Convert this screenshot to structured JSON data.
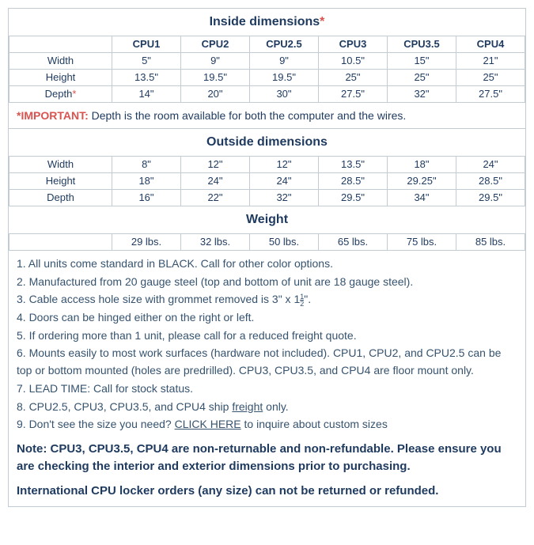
{
  "sections": {
    "inside": {
      "title": "Inside dimensions",
      "hasAsterisk": true
    },
    "outside": {
      "title": "Outside dimensions"
    },
    "weight": {
      "title": "Weight"
    }
  },
  "columns": [
    "CPU1",
    "CPU2",
    "CPU2.5",
    "CPU3",
    "CPU3.5",
    "CPU4"
  ],
  "inside": {
    "rows": {
      "width": {
        "label": "Width",
        "values": [
          "5\"",
          "9\"",
          "9\"",
          "10.5\"",
          "15\"",
          "21\""
        ]
      },
      "height": {
        "label": "Height",
        "values": [
          "13.5\"",
          "19.5\"",
          "19.5\"",
          "25\"",
          "25\"",
          "25\""
        ]
      },
      "depth": {
        "label": "Depth",
        "hasAsterisk": true,
        "values": [
          "14\"",
          "20\"",
          "30\"",
          "27.5\"",
          "32\"",
          "27.5\""
        ]
      }
    }
  },
  "important": {
    "label": "*IMPORTANT:",
    "text": " Depth is the room available for both the computer and the wires."
  },
  "outside": {
    "rows": {
      "width": {
        "label": "Width",
        "values": [
          "8\"",
          "12\"",
          "12\"",
          "13.5\"",
          "18\"",
          "24\""
        ]
      },
      "height": {
        "label": "Height",
        "values": [
          "18\"",
          "24\"",
          "24\"",
          "28.5\"",
          "29.25\"",
          "28.5\""
        ]
      },
      "depth": {
        "label": "Depth",
        "values": [
          "16\"",
          "22\"",
          "32\"",
          "29.5\"",
          "34\"",
          "29.5\""
        ]
      }
    }
  },
  "weight": {
    "values": [
      "29 lbs.",
      "32 lbs.",
      "50 lbs.",
      "65 lbs.",
      "75 lbs.",
      "85 lbs."
    ]
  },
  "notes": {
    "n1": "1. All units come standard in BLACK. Call for other color options.",
    "n2": "2. Manufactured from 20 gauge steel (top and bottom of unit are 18 gauge steel).",
    "n3_a": "3. Cable access hole size with grommet removed is 3\" x 1",
    "n3_num": "1",
    "n3_den": "2",
    "n3_b": "\".",
    "n4": "4. Doors can be hinged either on the right or left.",
    "n5": "5. If ordering more than 1 unit, please call for a reduced freight quote.",
    "n6": "6. Mounts easily to most work surfaces (hardware not included). CPU1, CPU2, and CPU2.5 can be top or bottom mounted (holes are predrilled). CPU3, CPU3.5, and CPU4 are floor mount only.",
    "n7": "7. LEAD TIME: Call for stock status.",
    "n8_a": "8. CPU2.5, CPU3, CPU3.5, and CPU4 ship ",
    "n8_link": "freight",
    "n8_b": " only.",
    "n9_a": "9. Don't see the size you need? ",
    "n9_link": "CLICK HERE",
    "n9_b": " to inquire about custom sizes"
  },
  "bold1": "Note: CPU3, CPU3.5, CPU4 are non-returnable and non-refundable. Please ensure you are checking the interior and exterior dimensions prior to purchasing.",
  "bold2": "International CPU locker orders (any size) can not be returned or refunded."
}
